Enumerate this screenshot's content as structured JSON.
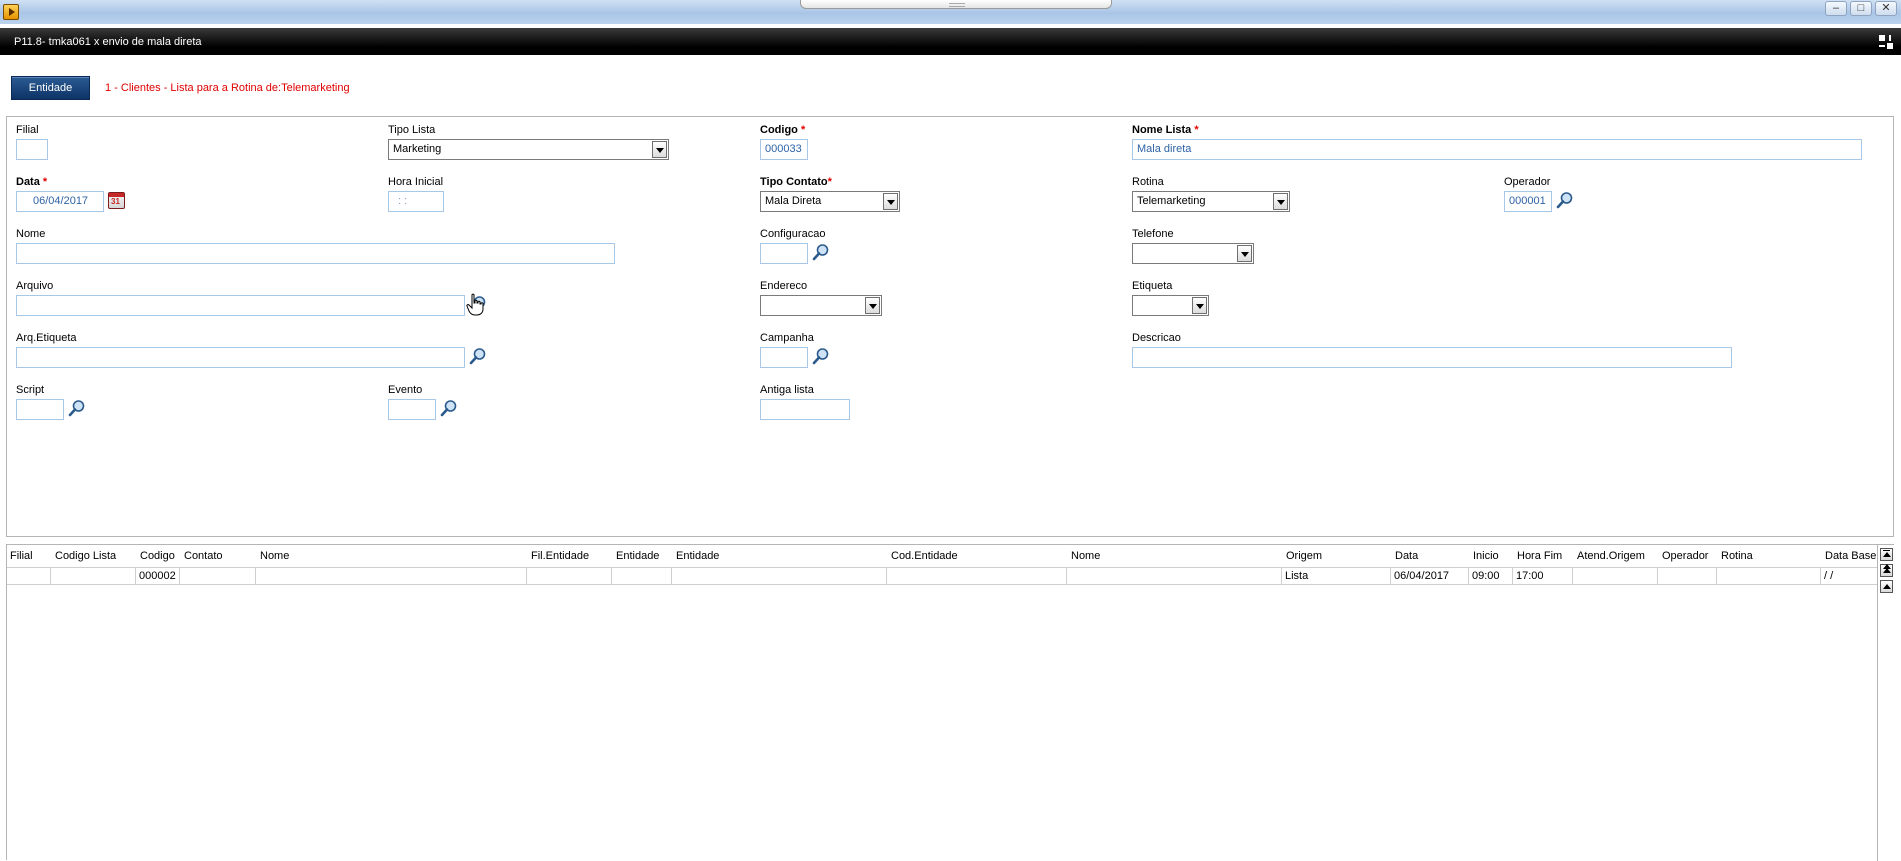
{
  "window": {
    "title": "P11.8- tmka061 x envio de mala direta"
  },
  "header": {
    "entity_button": "Entidade",
    "entity_caption": "1 - Clientes - Lista para a Rotina de:Telemarketing"
  },
  "form": {
    "filial": {
      "label": "Filial",
      "value": ""
    },
    "tipo_lista": {
      "label": "Tipo Lista",
      "value": "Marketing"
    },
    "codigo": {
      "label": "Codigo",
      "required": "*",
      "value": "000033"
    },
    "nome_lista": {
      "label": "Nome Lista",
      "required": "*",
      "value": "Mala direta"
    },
    "data": {
      "label": "Data",
      "required": "*",
      "value": "06/04/2017"
    },
    "hora_inicial": {
      "label": "Hora Inicial",
      "value": " : : "
    },
    "tipo_contato": {
      "label": "Tipo Contato",
      "required": "*",
      "value": "Mala Direta"
    },
    "rotina": {
      "label": "Rotina",
      "value": "Telemarketing"
    },
    "operador": {
      "label": "Operador",
      "value": "000001"
    },
    "nome": {
      "label": "Nome",
      "value": ""
    },
    "configuracao": {
      "label": "Configuracao",
      "value": ""
    },
    "telefone": {
      "label": "Telefone",
      "value": ""
    },
    "arquivo": {
      "label": "Arquivo",
      "value": ""
    },
    "endereco": {
      "label": "Endereco",
      "value": ""
    },
    "etiqueta": {
      "label": "Etiqueta",
      "value": ""
    },
    "arq_etiqueta": {
      "label": "Arq.Etiqueta",
      "value": ""
    },
    "campanha": {
      "label": "Campanha",
      "value": ""
    },
    "descricao": {
      "label": "Descricao",
      "value": ""
    },
    "script": {
      "label": "Script",
      "value": ""
    },
    "evento": {
      "label": "Evento",
      "value": ""
    },
    "antiga_lista": {
      "label": "Antiga lista",
      "value": ""
    }
  },
  "grid": {
    "columns": [
      "Filial",
      "Codigo Lista",
      "Codigo",
      "Contato",
      "Nome",
      "Fil.Entidade",
      "Entidade",
      "Entidade",
      "Cod.Entidade",
      "Nome",
      "Origem",
      "Data",
      "Inicio",
      "Hora Fim",
      "Atend.Origem",
      "Operador",
      "Rotina",
      "Data Base"
    ],
    "rows": [
      [
        "",
        "",
        "000002",
        "",
        "",
        "",
        "",
        "",
        "",
        "",
        "Lista",
        "06/04/2017",
        "09:00",
        "17:00",
        "",
        "",
        "",
        " / /"
      ]
    ]
  }
}
